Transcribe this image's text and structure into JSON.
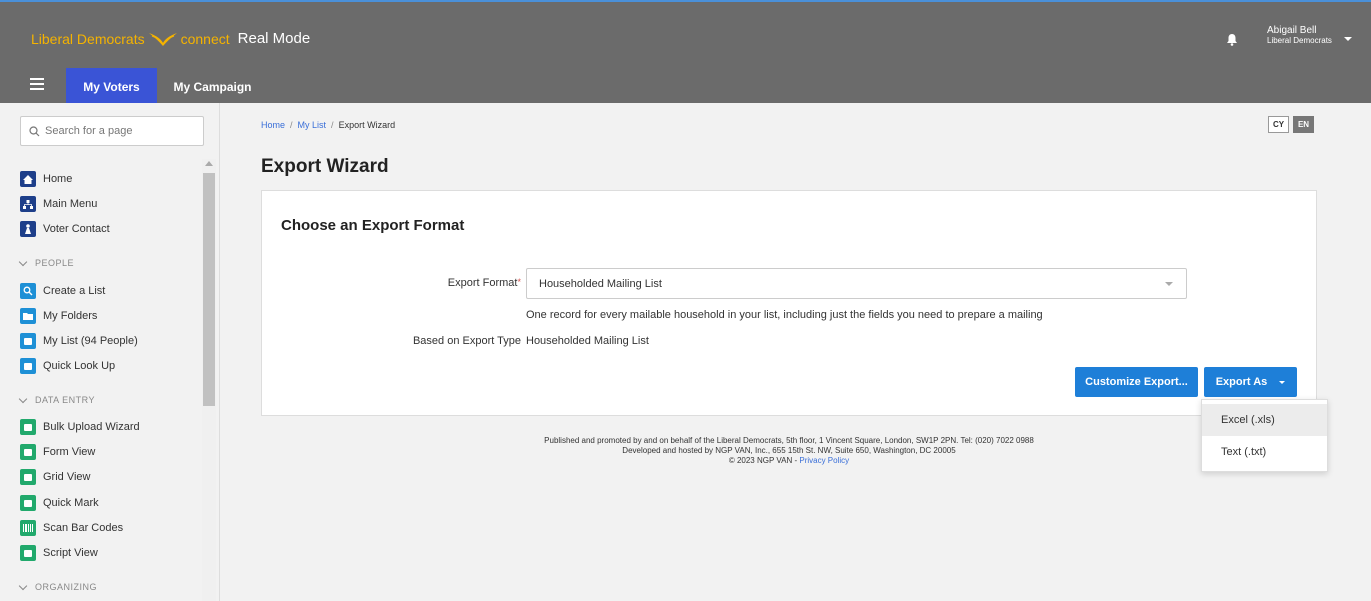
{
  "header": {
    "brand_name": "Liberal Democrats",
    "brand_connect": "connect",
    "mode": "Real Mode",
    "user_name": "Abigail Bell",
    "user_org": "Liberal Democrats",
    "brand_color": "#f5b300",
    "bar_color": "#6b6b6b"
  },
  "tabs": {
    "my_voters": "My Voters",
    "my_campaign": "My Campaign",
    "active_color": "#3a54d6"
  },
  "sidebar": {
    "search_placeholder": "Search for a page",
    "items": {
      "home": "Home",
      "main_menu": "Main Menu",
      "voter_contact": "Voter Contact",
      "people_section": "PEOPLE",
      "create_list": "Create a List",
      "my_folders": "My Folders",
      "my_list": "My List (94 People)",
      "quick_look_up": "Quick Look Up",
      "data_entry_section": "DATA ENTRY",
      "bulk_upload": "Bulk Upload Wizard",
      "form_view": "Form View",
      "grid_view": "Grid View",
      "quick_mark": "Quick Mark",
      "scan_bar_codes": "Scan Bar Codes",
      "script_view": "Script View",
      "organizing_section": "ORGANIZING"
    }
  },
  "breadcrumb": {
    "home": "Home",
    "sep1": "/",
    "my_list": "My List",
    "sep2": "/",
    "current": "Export Wizard"
  },
  "lang": {
    "cy": "CY",
    "en": "EN"
  },
  "page": {
    "title": "Export Wizard",
    "card_title": "Choose an Export Format",
    "export_format_label": "Export Format",
    "required_mark": "*",
    "export_format_value": "Householded Mailing List",
    "help_text": "One record for every mailable household in your list, including just the fields you need to prepare a mailing",
    "based_on_label": "Based on Export Type",
    "based_on_value": "Householded Mailing List",
    "customize_button": "Customize Export...",
    "export_as_button": "Export As",
    "button_color": "#1e7fd8"
  },
  "dropdown": {
    "excel": "Excel (.xls)",
    "text": "Text (.txt)"
  },
  "footer": {
    "line1": "Published and promoted by and on behalf of the Liberal Democrats, 5th floor, 1 Vincent Square, London, SW1P 2PN. Tel: (020) 7022 0988",
    "line2": "Developed and hosted by NGP VAN, Inc., 655 15th St. NW, Suite 650, Washington, DC 20005",
    "copyright": "© 2023 NGP VAN - ",
    "privacy": "Privacy Policy"
  }
}
